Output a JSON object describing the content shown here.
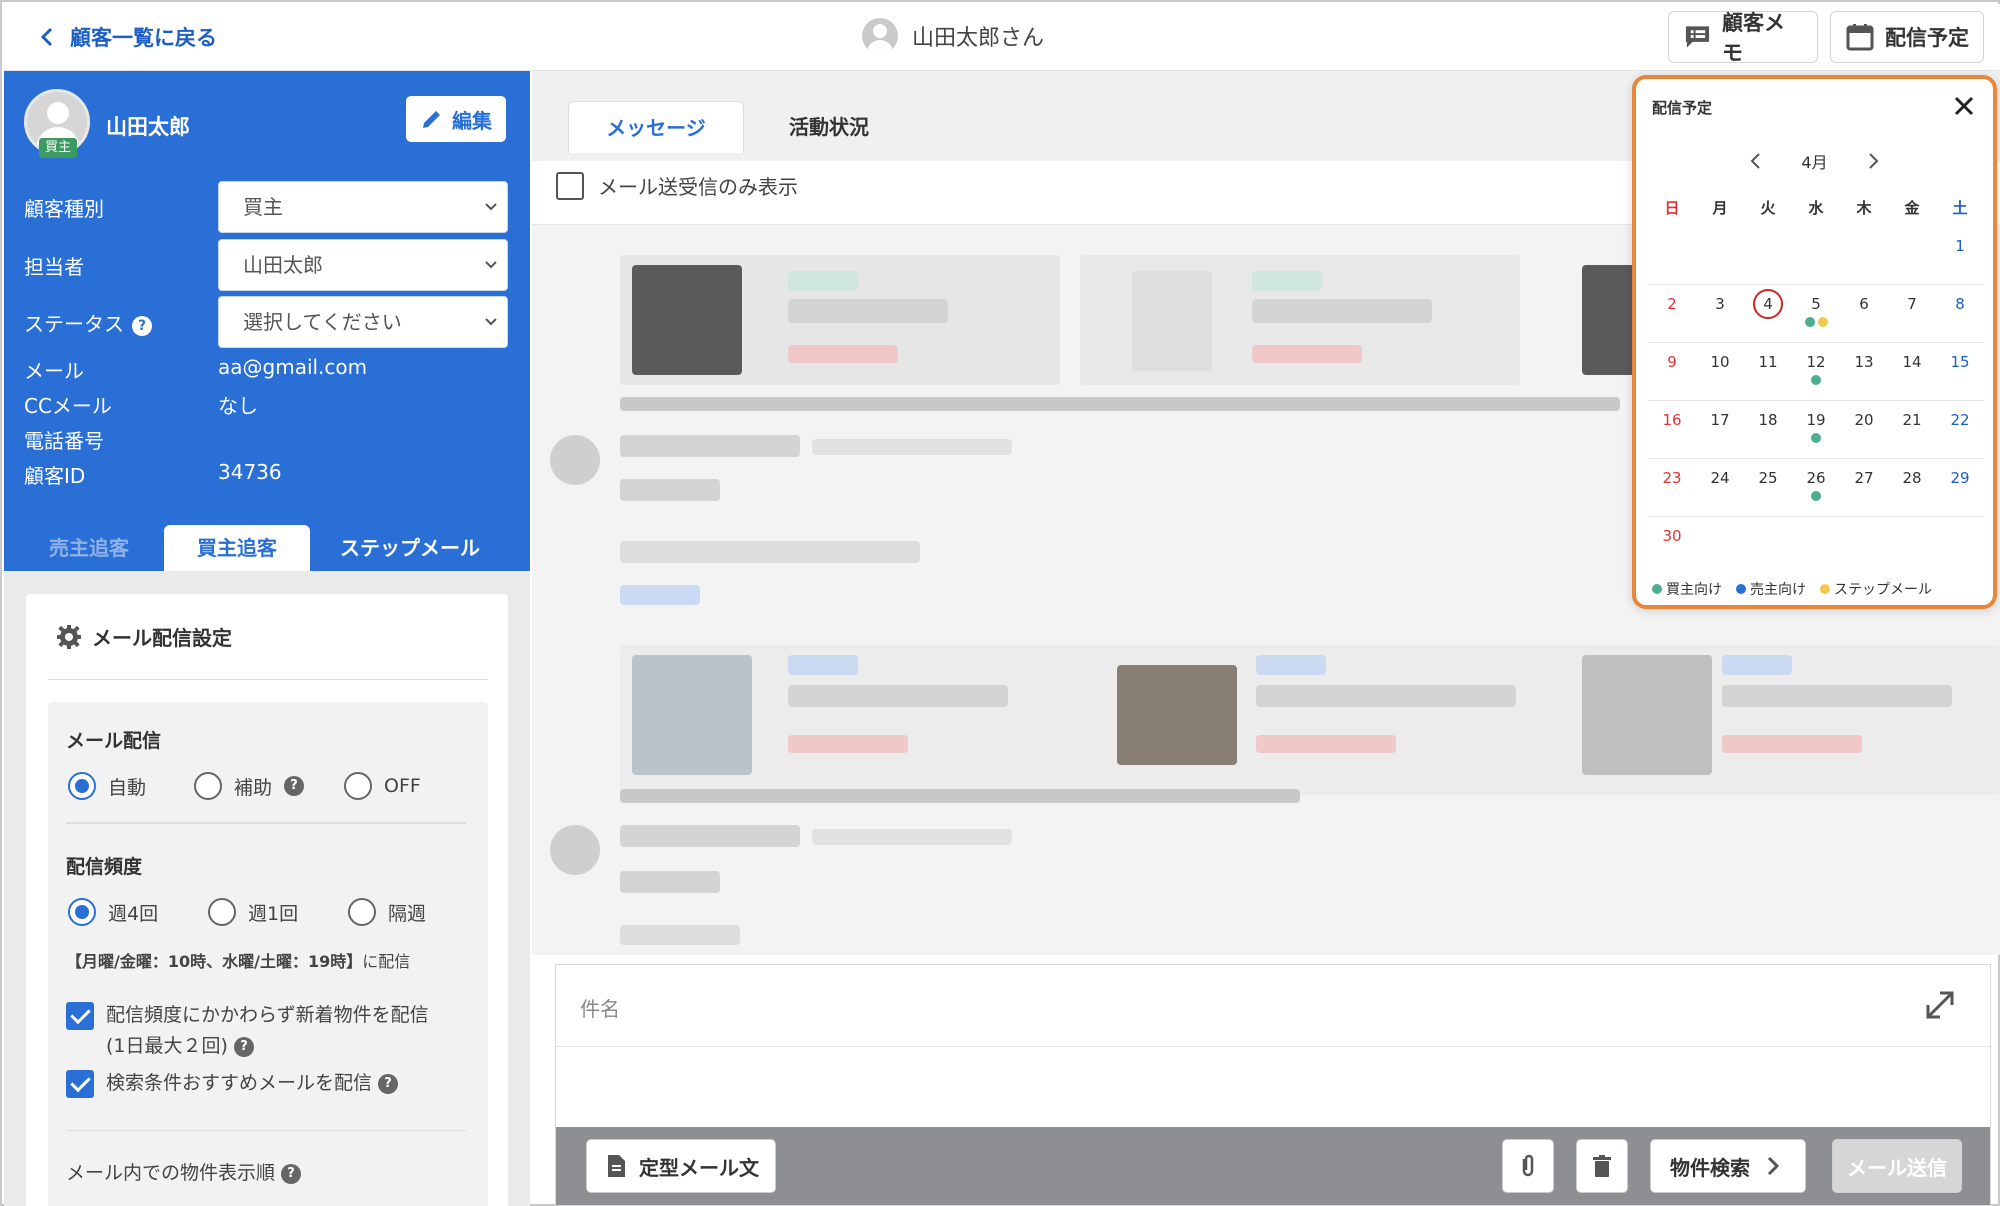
{
  "header": {
    "back_label": "顧客一覧に戻る",
    "customer_title": "山田太郎さん",
    "memo_button": "顧客メモ",
    "schedule_button": "配信予定"
  },
  "customer": {
    "name": "山田太郎",
    "badge": "買主",
    "edit_button": "編集",
    "fields": {
      "type_label": "顧客種別",
      "type_value": "買主",
      "owner_label": "担当者",
      "owner_value": "山田太郎",
      "status_label": "ステータス",
      "status_placeholder": "選択してください",
      "email_label": "メール",
      "email_value": "aa@gmail.com",
      "cc_label": "CCメール",
      "cc_value": "なし",
      "phone_label": "電話番号",
      "phone_value": "",
      "id_label": "顧客ID",
      "id_value": "34736"
    },
    "tabs": [
      "売主追客",
      "買主追客",
      "ステップメール"
    ],
    "active_tab": "買主追客"
  },
  "mail_settings": {
    "title": "メール配信設定",
    "delivery_title": "メール配信",
    "delivery_options": [
      "自動",
      "補助",
      "OFF"
    ],
    "delivery_selected": "自動",
    "frequency_title": "配信頻度",
    "frequency_options": [
      "週4回",
      "週1回",
      "隔週"
    ],
    "frequency_selected": "週4回",
    "schedule_note_bold": "【月曜/金曜：10時、水曜/土曜：19時】",
    "schedule_note_suffix": "に配信",
    "check_new_line1": "配信頻度にかかわらず新着物件を配信",
    "check_new_line2": "(1日最大２回)",
    "check_recommend": "検索条件おすすめメールを配信",
    "order_title": "メール内での物件表示順"
  },
  "main": {
    "tabs": [
      "メッセージ",
      "活動状況"
    ],
    "active_tab": "メッセージ",
    "filter_label": "メール送受信のみ表示"
  },
  "compose": {
    "subject_placeholder": "件名",
    "template_button": "定型メール文",
    "property_search_button": "物件検索",
    "send_button": "メール送信"
  },
  "calendar": {
    "title": "配信予定",
    "month": "4月",
    "weekdays": [
      "日",
      "月",
      "火",
      "水",
      "木",
      "金",
      "土"
    ],
    "weeks": [
      [
        "",
        "",
        "",
        "",
        "",
        "",
        "1"
      ],
      [
        "2",
        "3",
        "4",
        "5",
        "6",
        "7",
        "8"
      ],
      [
        "9",
        "10",
        "11",
        "12",
        "13",
        "14",
        "15"
      ],
      [
        "16",
        "17",
        "18",
        "19",
        "20",
        "21",
        "22"
      ],
      [
        "23",
        "24",
        "25",
        "26",
        "27",
        "28",
        "29"
      ],
      [
        "30",
        "",
        "",
        "",
        "",
        "",
        ""
      ]
    ],
    "today": "4",
    "events": {
      "5": [
        "buyer",
        "step"
      ],
      "12": [
        "buyer"
      ],
      "19": [
        "buyer"
      ],
      "26": [
        "buyer"
      ]
    },
    "legend": [
      {
        "key": "buyer",
        "label": "買主向け",
        "color": "#4caf8f"
      },
      {
        "key": "seller",
        "label": "売主向け",
        "color": "#2a6fd6"
      },
      {
        "key": "step",
        "label": "ステップメール",
        "color": "#f2c94c"
      }
    ]
  },
  "colors": {
    "accent": "#2a6fd6",
    "highlight": "#e8873a",
    "sunday": "#e03131",
    "saturday": "#1d5fc4"
  }
}
